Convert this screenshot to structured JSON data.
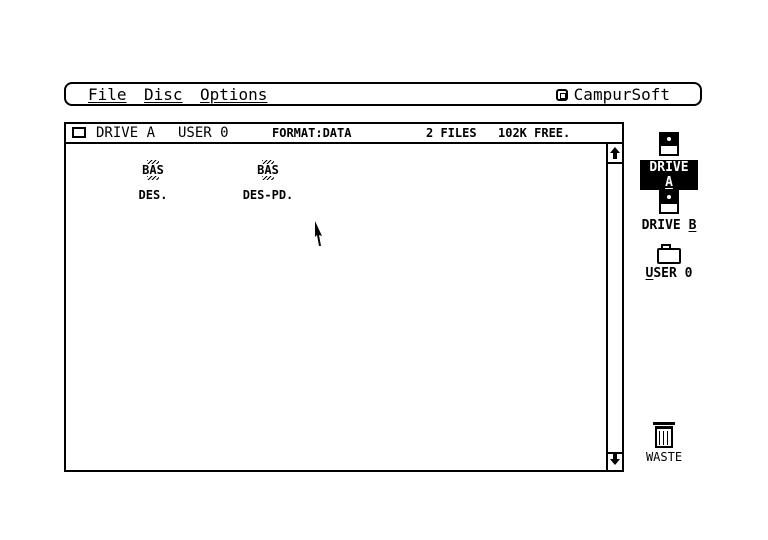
{
  "menubar": {
    "file_first": "F",
    "file_rest": "ile",
    "disc_first": "D",
    "disc_rest": "isc",
    "options_first": "O",
    "options_rest": "ptions",
    "brand": "CampurSoft"
  },
  "window": {
    "drive": "DRIVE A",
    "user": "USER 0",
    "format": "FORMAT:DATA",
    "files": "2 FILES",
    "free": "102K FREE."
  },
  "files": [
    {
      "type": "BAS",
      "name": "DES."
    },
    {
      "type": "BAS",
      "name": "DES-PD."
    }
  ],
  "desktop": {
    "drive_a": {
      "label_pre": "DRIVE ",
      "label_key": "A"
    },
    "drive_b": {
      "label_pre": "DRIVE ",
      "label_key": "B"
    },
    "user_0": {
      "label_key": "U",
      "label_rest": "SER 0"
    },
    "waste": {
      "label": "WASTE"
    }
  },
  "colors": {
    "foreground": "#000000",
    "background": "#ffffff"
  },
  "icons": [
    "close-box-icon",
    "up-arrow-icon",
    "down-arrow-icon",
    "disk-icon",
    "folder-icon",
    "trash-icon",
    "mouse-pointer-icon"
  ]
}
